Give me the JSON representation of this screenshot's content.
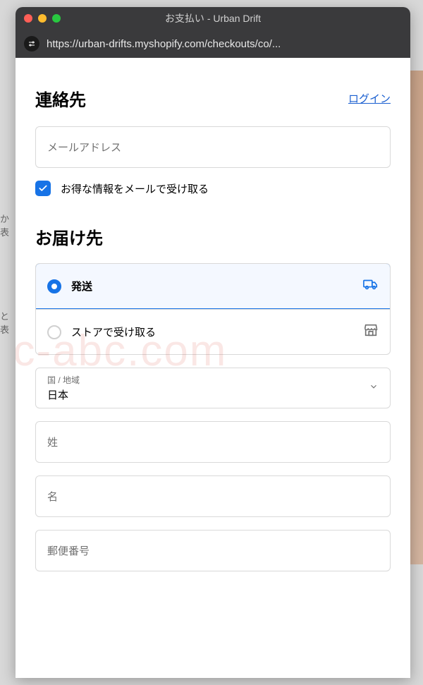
{
  "window": {
    "title": "お支払い - Urban Drift",
    "url": "https://urban-drifts.myshopify.com/checkouts/co/..."
  },
  "contact": {
    "heading": "連絡先",
    "login": "ログイン",
    "email_placeholder": "メールアドレス",
    "newsletter_label": "お得な情報をメールで受け取る",
    "newsletter_checked": true
  },
  "delivery": {
    "heading": "お届け先",
    "options": [
      {
        "label": "発送",
        "selected": true,
        "icon": "truck"
      },
      {
        "label": "ストアで受け取る",
        "selected": false,
        "icon": "store"
      }
    ],
    "country_label": "国 / 地域",
    "country_value": "日本",
    "last_name_placeholder": "姓",
    "first_name_placeholder": "名",
    "postal_placeholder": "郵便番号"
  },
  "watermark": "ec-abc.com",
  "bg_fragments": {
    "left1": "か",
    "left2": "表",
    "left3": "と",
    "left4": "表"
  }
}
